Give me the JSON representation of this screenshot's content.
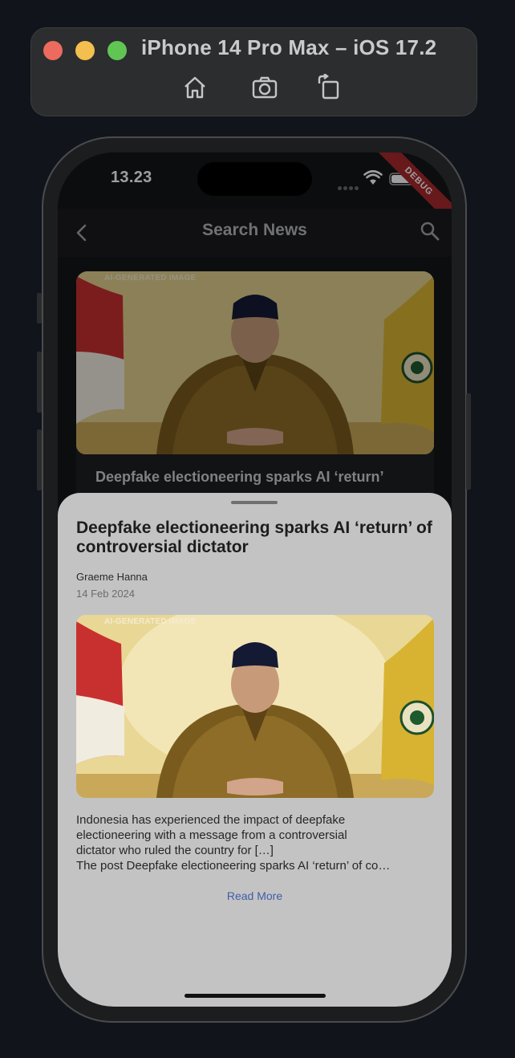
{
  "simulator": {
    "title": "iPhone 14 Pro Max – iOS 17.2",
    "toolbar_icons": [
      "home-icon",
      "screenshot-icon",
      "rotate-icon"
    ]
  },
  "status_bar": {
    "time": "13.23",
    "debug_banner": "DEBUG"
  },
  "appbar": {
    "title": "Search News",
    "back_icon": "chevron-left-icon",
    "search_icon": "search-icon"
  },
  "card": {
    "image_label": "AI-GENERATED IMAGE",
    "title": "Deepfake electioneering sparks AI ‘return’"
  },
  "sheet": {
    "title": "Deepfake electioneering sparks AI ‘return’ of controversial dictator",
    "author": "Graeme Hanna",
    "date": "14 Feb 2024",
    "image_label": "AI-GENERATED IMAGE",
    "body_lines": [
      "Indonesia has experienced the impact of deepfake",
      "electioneering with a message from a controversial",
      "dictator who ruled the country for […]",
      "The post Deepfake electioneering sparks AI ‘return’ of co…"
    ],
    "read_more": "Read More"
  },
  "colors": {
    "accent_link": "#3f5ea8",
    "sheet_bg": "#c3c3c3",
    "debug": "#a8292d"
  }
}
